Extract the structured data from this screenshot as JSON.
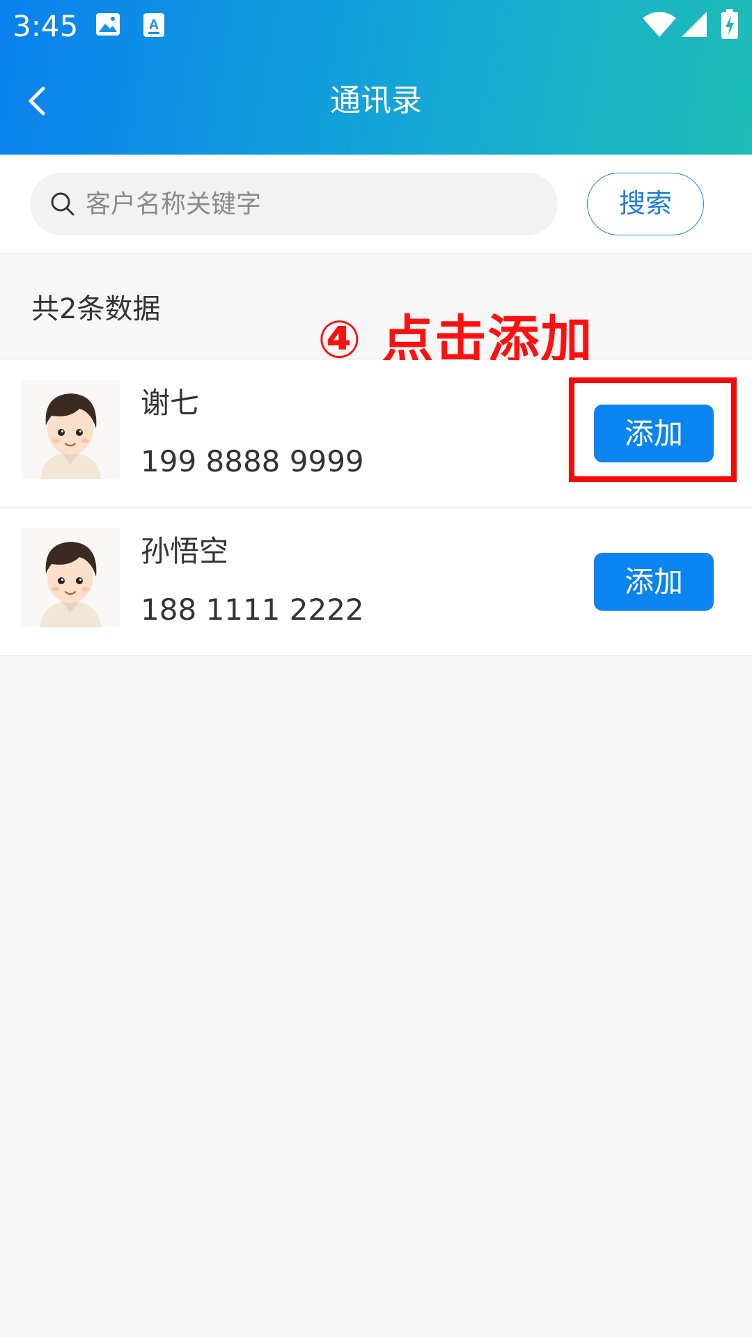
{
  "status_bar": {
    "time": "3:45",
    "icons": [
      "image-icon",
      "a-icon",
      "wifi-icon",
      "signal-icon",
      "battery-icon"
    ]
  },
  "header": {
    "title": "通讯录",
    "back_icon": "chevron-left-icon"
  },
  "search": {
    "placeholder": "客户名称关键字",
    "value": "",
    "button_label": "搜索"
  },
  "summary": {
    "count_text": "共2条数据"
  },
  "annotation": {
    "text": "④ 点击添加",
    "color": "#ff1010"
  },
  "contacts": [
    {
      "name": "谢七",
      "phone": "199 8888 9999",
      "add_label": "添加"
    },
    {
      "name": "孙悟空",
      "phone": "188 1111 2222",
      "add_label": "添加"
    }
  ],
  "colors": {
    "header_gradient_start": "#0a80ee",
    "header_gradient_end": "#1fbdb6",
    "primary_button": "#0a84f0",
    "highlight_box": "#f40a0a"
  }
}
